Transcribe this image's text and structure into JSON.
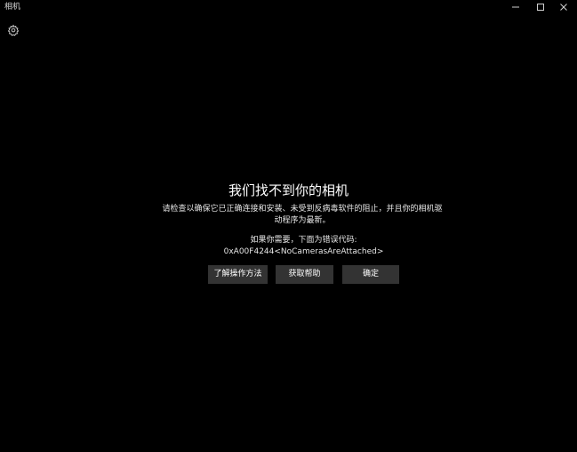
{
  "window": {
    "title": "相机",
    "controls": {
      "minimize_icon": "minimize-icon",
      "maximize_icon": "maximize-icon",
      "close_icon": "close-icon"
    }
  },
  "toolbar": {
    "settings_icon": "gear-icon"
  },
  "error": {
    "heading": "我们找不到你的相机",
    "description": "请检查以确保它已正确连接和安装、未受到反病毒软件的阻止，并且你的相机驱动程序为最新。",
    "code_label": "如果你需要，下面为错误代码:",
    "code_value": "0xA00F4244<NoCamerasAreAttached>"
  },
  "buttons": {
    "learn_label": "了解操作方法",
    "help_label": "获取帮助",
    "ok_label": "确定"
  },
  "colors": {
    "background": "#000000",
    "button_bg": "#333333",
    "text": "#ffffff"
  }
}
